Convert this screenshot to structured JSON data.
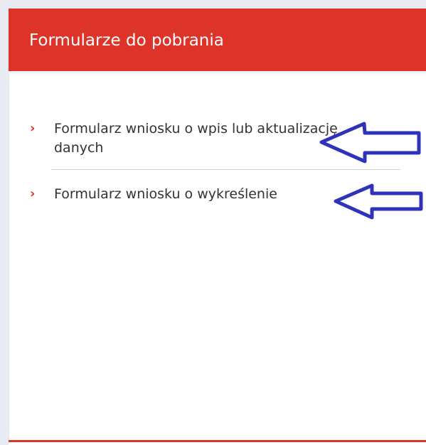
{
  "panel": {
    "title": "Formularze do pobrania"
  },
  "items": [
    {
      "bullet": "›",
      "label": "Formularz wniosku o wpis lub aktualizację danych"
    },
    {
      "bullet": "›",
      "label": "Formularz wniosku o wykreślenie"
    }
  ],
  "annotations": [
    {
      "icon": "left-arrow-icon",
      "color": "#2e33ba"
    },
    {
      "icon": "left-arrow-icon",
      "color": "#2e33ba"
    }
  ],
  "colors": {
    "accent": "#dd3328",
    "text": "#333333",
    "annotation": "#2e33ba"
  }
}
